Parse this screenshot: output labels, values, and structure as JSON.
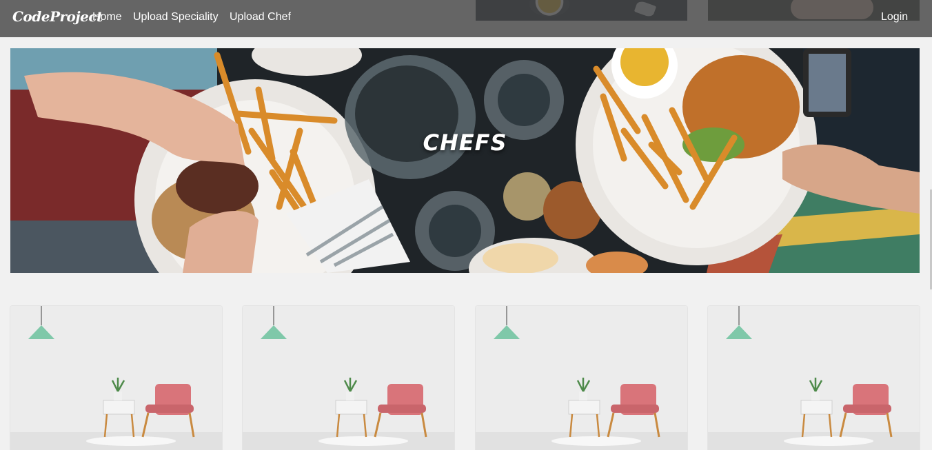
{
  "navbar": {
    "brand": "CodeProject",
    "links": [
      "Home",
      "Upload Speciality",
      "Upload Chef"
    ],
    "login": "Login"
  },
  "hero": {
    "title": "CHEFS",
    "image": "food-table-photo"
  },
  "cards": [
    {
      "image": "room-chair-photo"
    },
    {
      "image": "room-chair-photo"
    },
    {
      "image": "room-chair-photo"
    },
    {
      "image": "room-chair-photo"
    }
  ],
  "colors": {
    "navbar_bg": "#464646",
    "page_bg": "#f1f1f1",
    "chair": "#d9747a",
    "lamp": "#7fc8a9"
  }
}
